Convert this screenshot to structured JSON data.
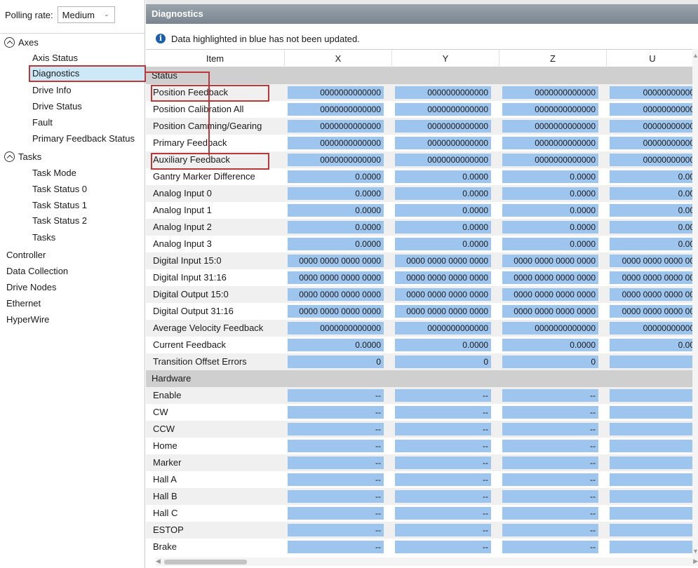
{
  "polling": {
    "label": "Polling rate:",
    "value": "Medium"
  },
  "tree": {
    "axes": "Axes",
    "axes_items": [
      "Axis Status",
      "Diagnostics",
      "Drive Info",
      "Drive Status",
      "Fault",
      "Primary Feedback Status"
    ],
    "tasks": "Tasks",
    "tasks_items": [
      "Task Mode",
      "Task Status 0",
      "Task Status 1",
      "Task Status 2",
      "Tasks"
    ],
    "roots": [
      "Controller",
      "Data Collection",
      "Drive Nodes",
      "Ethernet",
      "HyperWire"
    ],
    "selected": "Diagnostics"
  },
  "panel": {
    "title": "Diagnostics",
    "info": "Data highlighted in blue has not been updated."
  },
  "columns": [
    "Item",
    "X",
    "Y",
    "Z",
    "U"
  ],
  "sections": {
    "status": "Status",
    "hardware": "Hardware"
  },
  "status_rows": [
    {
      "name": "Position Feedback",
      "values": [
        "0000000000000",
        "0000000000000",
        "0000000000000",
        "00000000000"
      ]
    },
    {
      "name": "Position Calibration All",
      "values": [
        "0000000000000",
        "0000000000000",
        "0000000000000",
        "00000000000"
      ]
    },
    {
      "name": "Position Camming/Gearing",
      "values": [
        "0000000000000",
        "0000000000000",
        "0000000000000",
        "00000000000"
      ]
    },
    {
      "name": "Primary Feedback",
      "values": [
        "0000000000000",
        "0000000000000",
        "0000000000000",
        "00000000000"
      ]
    },
    {
      "name": "Auxiliary Feedback",
      "values": [
        "0000000000000",
        "0000000000000",
        "0000000000000",
        "00000000000"
      ]
    },
    {
      "name": "Gantry Marker Difference",
      "values": [
        "0.0000",
        "0.0000",
        "0.0000",
        "0.00"
      ]
    },
    {
      "name": "Analog Input 0",
      "values": [
        "0.0000",
        "0.0000",
        "0.0000",
        "0.00"
      ]
    },
    {
      "name": "Analog Input 1",
      "values": [
        "0.0000",
        "0.0000",
        "0.0000",
        "0.00"
      ]
    },
    {
      "name": "Analog Input 2",
      "values": [
        "0.0000",
        "0.0000",
        "0.0000",
        "0.00"
      ]
    },
    {
      "name": "Analog Input 3",
      "values": [
        "0.0000",
        "0.0000",
        "0.0000",
        "0.00"
      ]
    },
    {
      "name": "Digital Input 15:0",
      "values": [
        "0000 0000 0000 0000",
        "0000 0000 0000 0000",
        "0000 0000 0000 0000",
        "0000 0000 0000 00"
      ]
    },
    {
      "name": "Digital Input 31:16",
      "values": [
        "0000 0000 0000 0000",
        "0000 0000 0000 0000",
        "0000 0000 0000 0000",
        "0000 0000 0000 00"
      ]
    },
    {
      "name": "Digital Output 15:0",
      "values": [
        "0000 0000 0000 0000",
        "0000 0000 0000 0000",
        "0000 0000 0000 0000",
        "0000 0000 0000 00"
      ]
    },
    {
      "name": "Digital Output 31:16",
      "values": [
        "0000 0000 0000 0000",
        "0000 0000 0000 0000",
        "0000 0000 0000 0000",
        "0000 0000 0000 00"
      ]
    },
    {
      "name": "Average Velocity Feedback",
      "values": [
        "0000000000000",
        "0000000000000",
        "0000000000000",
        "00000000000"
      ]
    },
    {
      "name": "Current Feedback",
      "values": [
        "0.0000",
        "0.0000",
        "0.0000",
        "0.00"
      ]
    },
    {
      "name": "Transition Offset Errors",
      "values": [
        "0",
        "0",
        "0",
        ""
      ]
    }
  ],
  "hardware_rows": [
    {
      "name": "Enable",
      "values": [
        "--",
        "--",
        "--",
        ""
      ]
    },
    {
      "name": "CW",
      "values": [
        "--",
        "--",
        "--",
        ""
      ]
    },
    {
      "name": "CCW",
      "values": [
        "--",
        "--",
        "--",
        ""
      ]
    },
    {
      "name": "Home",
      "values": [
        "--",
        "--",
        "--",
        ""
      ]
    },
    {
      "name": "Marker",
      "values": [
        "--",
        "--",
        "--",
        ""
      ]
    },
    {
      "name": "Hall A",
      "values": [
        "--",
        "--",
        "--",
        ""
      ]
    },
    {
      "name": "Hall B",
      "values": [
        "--",
        "--",
        "--",
        ""
      ]
    },
    {
      "name": "Hall C",
      "values": [
        "--",
        "--",
        "--",
        ""
      ]
    },
    {
      "name": "ESTOP",
      "values": [
        "--",
        "--",
        "--",
        ""
      ]
    },
    {
      "name": "Brake",
      "values": [
        "--",
        "--",
        "--",
        ""
      ]
    }
  ],
  "colors": {
    "cell_blue": "#9ec5ee",
    "header": "#8a949d",
    "annotation_red": "#b9383a",
    "selected": "#cde8f7"
  },
  "icons": {
    "expand": "chevron-up-circle-icon",
    "info": "info-icon",
    "dropdown": "chevron-down-icon"
  }
}
